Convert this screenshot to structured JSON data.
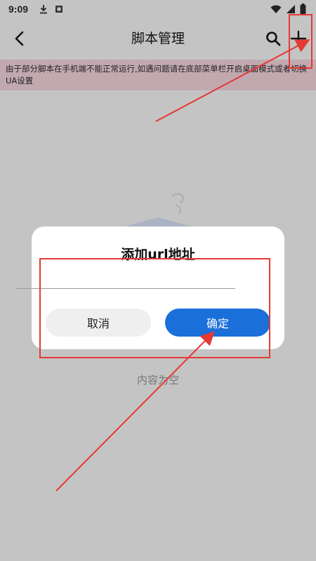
{
  "status_bar": {
    "time": "9:09",
    "icons": [
      "download-icon",
      "app-icon",
      "wifi-icon",
      "signal-icon",
      "battery-icon"
    ]
  },
  "app_bar": {
    "title": "脚本管理",
    "icons": {
      "back": "back-arrow-icon",
      "search": "search-icon",
      "add": "plus-icon"
    }
  },
  "notice": {
    "text": "由于部分脚本在手机端不能正常运行,如遇问题请在底部菜单栏开启桌面模式或者切换UA设置"
  },
  "empty_state": {
    "text": "内容为空"
  },
  "dialog": {
    "title": "添加url地址",
    "input_value": "",
    "cancel_label": "取消",
    "ok_label": "确定"
  },
  "colors": {
    "primary": "#1a6fd9",
    "annotation": "#e53935",
    "notice_bg": "#c2a9b0",
    "overlay_bg": "#c4c4c4"
  }
}
